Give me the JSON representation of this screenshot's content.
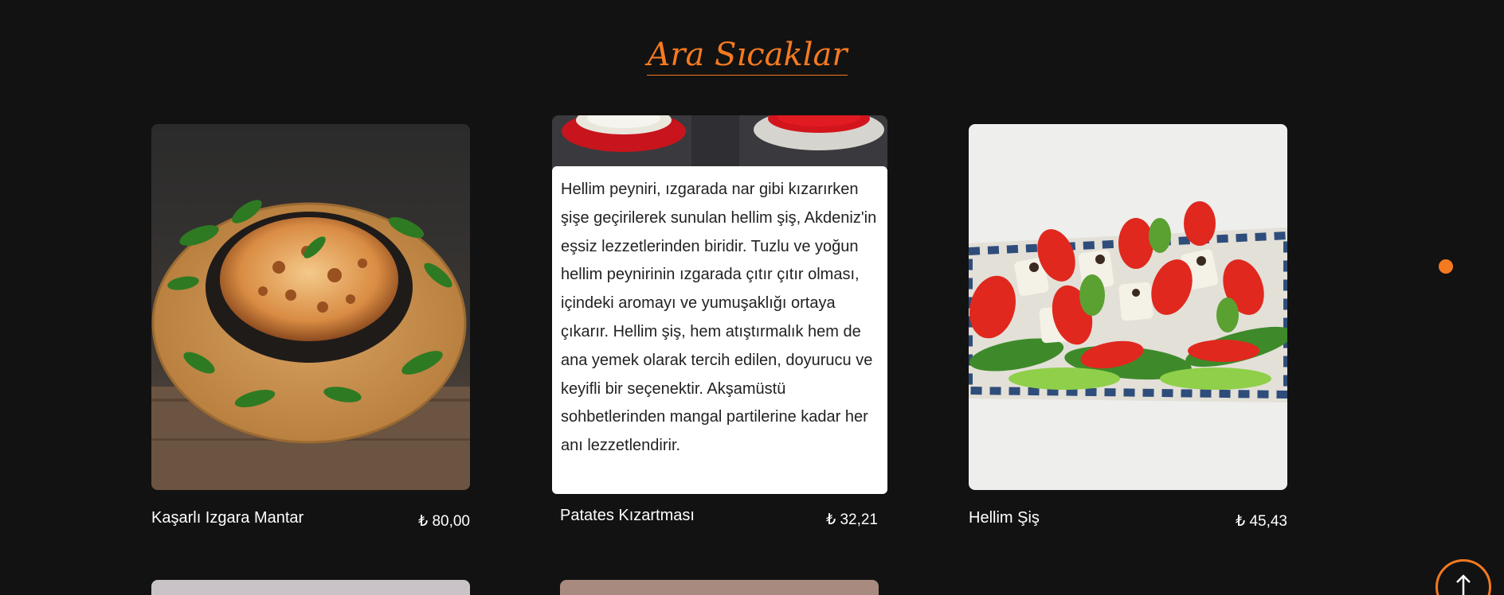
{
  "section": {
    "title": "Ara Sıcaklar"
  },
  "products": [
    {
      "name": "Kaşarlı Izgara Mantar",
      "price": "₺ 80,00",
      "image": "baked-mushroom-skillet-image"
    },
    {
      "name": "Patates Kızartması",
      "price": "₺ 32,21",
      "image": "sauce-cups-image",
      "description": "Hellim peyniri, ızgarada nar gibi kızarırken şişe geçirilerek sunulan hellim şiş, Akdeniz'in eşsiz lezzetlerinden biridir. Tuzlu ve yoğun hellim peynirinin ızgarada çıtır çıtır olması, içindeki aromayı ve yumuşaklığı ortaya çıkarır. Hellim şiş, hem atıştırmalık hem de ana yemek olarak tercih edilen, doyurucu ve keyifli bir seçenektir. Akşamüstü sohbetlerinden mangal partilerine kadar her anı lezzetlendirir."
    },
    {
      "name": "Hellim Şiş",
      "price": "₺ 45,43",
      "image": "halloumi-skewer-plate-image"
    }
  ],
  "controls": {
    "scroll_top_icon": "arrow-up-icon",
    "indicator_icon": "carousel-dot-icon"
  },
  "colors": {
    "background": "#121212",
    "accent": "#f47a20",
    "text": "#ffffff",
    "popup_background": "#ffffff"
  }
}
